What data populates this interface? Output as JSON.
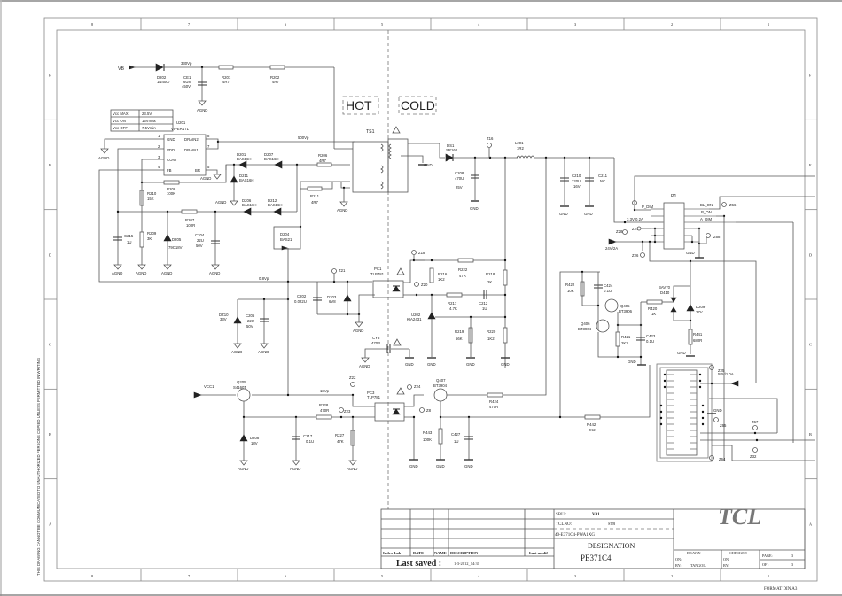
{
  "border": {
    "columns": [
      "8",
      "7",
      "6",
      "5",
      "4",
      "3",
      "2",
      "1"
    ],
    "rows": [
      "F",
      "E",
      "D",
      "C",
      "B",
      "A"
    ],
    "side_notice": "THIS DRAWING CANNOT BE COMMUNICATED TO UNAUTHORIZED PERSONS COPIED UNLESS PERMITTED IN WRITING",
    "format": "FORMAT DIN A3"
  },
  "zones": {
    "hot": "HOT",
    "cold": "COLD"
  },
  "vcc_table": [
    {
      "label": "Vcc MAX",
      "value": "23.5V"
    },
    {
      "label": "Vcc  ON",
      "value": "15Vmax"
    },
    {
      "label": "Vcc OFF",
      "value": "7.5Vmin"
    }
  ],
  "ic": {
    "ref": "U201",
    "part": "VIPER17L",
    "pins_left": [
      {
        "num": "1",
        "name": "GND"
      },
      {
        "num": "2",
        "name": "VDD"
      },
      {
        "num": "3",
        "name": "CONT"
      },
      {
        "num": "4",
        "name": "FB"
      }
    ],
    "pins_right": [
      {
        "num": "8",
        "name": "DRAIN2"
      },
      {
        "num": "7",
        "name": "DRAIN1"
      },
      {
        "num": "5",
        "name": "BR"
      }
    ]
  },
  "nets": {
    "vb": "VB",
    "v330": "330Vp",
    "v500": "500Vp",
    "v08": "0.8Vp",
    "v18": "18Vp",
    "vcc1": "VCC1",
    "v24": "24V/2A",
    "v33": "3.3V/0.2A",
    "v58": "58V/1.0A",
    "p_dim": "P_DIM",
    "bl_on": "BL_ON",
    "p_on": "P_ON",
    "a_dim": "A_DIM",
    "agnd": "AGND",
    "gnd": "GND"
  },
  "components": {
    "d202": {
      "ref": "D202",
      "val": "1N4007"
    },
    "ce1": {
      "ref": "CE1",
      "val": "6U8",
      "val2": "450V"
    },
    "r201": {
      "ref": "R201",
      "val": "4R7"
    },
    "r202": {
      "ref": "R202",
      "val": "4R7"
    },
    "ts1": {
      "ref": "TS1"
    },
    "d201": {
      "ref": "D201",
      "val": "BAS16H"
    },
    "d207": {
      "ref": "D207",
      "val": "BAS16H"
    },
    "d211": {
      "ref": "D211",
      "val": "BAS16H"
    },
    "d206": {
      "ref": "D206",
      "val": "BAS16H"
    },
    "d212": {
      "ref": "D212",
      "val": "BAS16H"
    },
    "r206": {
      "ref": "R206",
      "val": "4R7"
    },
    "r211": {
      "ref": "R211",
      "val": "4R7"
    },
    "r208": {
      "ref": "R208",
      "val": "100K"
    },
    "r210": {
      "ref": "R210",
      "val": "15K"
    },
    "r207": {
      "ref": "R207",
      "val": "100R"
    },
    "r209": {
      "ref": "R209",
      "val": "3K"
    },
    "c215": {
      "ref": "C215",
      "val": "1U"
    },
    "d205": {
      "ref": "D205",
      "val": "79C18V"
    },
    "c204": {
      "ref": "C204",
      "val": "22U",
      "val2": "50V"
    },
    "d204": {
      "ref": "D204",
      "val": "BAS21"
    },
    "ds1": {
      "ref": "DS1",
      "val": "SR160"
    },
    "c208": {
      "ref": "C208",
      "val": "470U",
      "val2": "25V"
    },
    "l201": {
      "ref": "L201",
      "val": "1R2"
    },
    "c210": {
      "ref": "C210",
      "val": "220U",
      "val2": "16V"
    },
    "c211": {
      "ref": "C211",
      "val": "NC"
    },
    "p1": {
      "ref": "P1"
    },
    "pc1": {
      "ref": "PC1",
      "val": "TLP781"
    },
    "pc3": {
      "ref": "PC3",
      "val": "TLP781"
    },
    "c202": {
      "ref": "C202",
      "val": "0.022U"
    },
    "d203": {
      "ref": "D203",
      "val": "6V8"
    },
    "dz10": {
      "ref": "DZ10",
      "val": "33V"
    },
    "c206": {
      "ref": "C206",
      "val": "22U",
      "val2": "50V"
    },
    "r222": {
      "ref": "R222",
      "val": "47R"
    },
    "r216": {
      "ref": "R216",
      "val": "1K2"
    },
    "r217": {
      "ref": "R217",
      "val": "4.7K"
    },
    "c212": {
      "ref": "C212",
      "val": "1U"
    },
    "r218": {
      "ref": "R218",
      "val": "2K"
    },
    "u202": {
      "ref": "U202",
      "val": "KIA2431"
    },
    "r219": {
      "ref": "R219",
      "val": "56K"
    },
    "r220": {
      "ref": "R220",
      "val": "1K2"
    },
    "cy3": {
      "ref": "CY3",
      "val": "470P"
    },
    "q205": {
      "ref": "Q205",
      "val": "S4160T"
    },
    "d208": {
      "ref": "D208",
      "val": "18V"
    },
    "c217": {
      "ref": "C217",
      "val": "0.1U"
    },
    "r228": {
      "ref": "R228",
      "val": "470R"
    },
    "r227": {
      "ref": "R227",
      "val": "47K"
    },
    "q407": {
      "ref": "Q407",
      "val": "BT3904"
    },
    "r443": {
      "ref": "R443",
      "val": "100K"
    },
    "c427": {
      "ref": "C427",
      "val": "1U"
    },
    "r424": {
      "ref": "R424",
      "val": "470R"
    },
    "r442": {
      "ref": "R442",
      "val": "2K2"
    },
    "r422": {
      "ref": "R422",
      "val": "10K"
    },
    "c424": {
      "ref": "C424",
      "val": "0.1U"
    },
    "q405": {
      "ref": "Q405",
      "val": "BT3906"
    },
    "q406": {
      "ref": "Q406",
      "val": "BT3904"
    },
    "r421": {
      "ref": "R421",
      "val": "2K2"
    },
    "c423": {
      "ref": "C423",
      "val": "0.1U"
    },
    "r420": {
      "ref": "R420",
      "val": "1K"
    },
    "d410": {
      "ref": "D410",
      "val": "BAV70"
    },
    "d209": {
      "ref": "D209",
      "val": "27V"
    },
    "r441": {
      "ref": "R441",
      "val": "680R"
    }
  },
  "testpoints": [
    "Z16",
    "Z18",
    "Z20",
    "Z21",
    "Z22",
    "Z23",
    "Z24",
    "Z8",
    "Z28",
    "Z27",
    "Z26",
    "Z66",
    "Z68",
    "Z25",
    "Z65",
    "Z67",
    "Z64",
    "Z32"
  ],
  "title_block": {
    "sbu_label": "SBU :",
    "sbu_value": "V01",
    "tclno_label": "TCLNO:",
    "tclno_value": "STB",
    "part_no": "40-E371C4-PWA1XG",
    "designation_label": "DESIGNATION",
    "designation": "PE371C4",
    "rev_headers": [
      "Index-Lab",
      "DATE",
      "NAME",
      "DESCRIPTION",
      "Last modif"
    ],
    "last_saved_label": "Last saved :",
    "last_saved": "1-3-2012_14:31",
    "logo": "TCL",
    "drawn_label": "DRAWN",
    "checked_label": "CHECKED",
    "on_label": "ON:",
    "by_label": "BY:",
    "drawn_by": "TANGOL",
    "page_label": "PAGE:",
    "page": "3",
    "of_label": "OF :",
    "of": "3"
  }
}
